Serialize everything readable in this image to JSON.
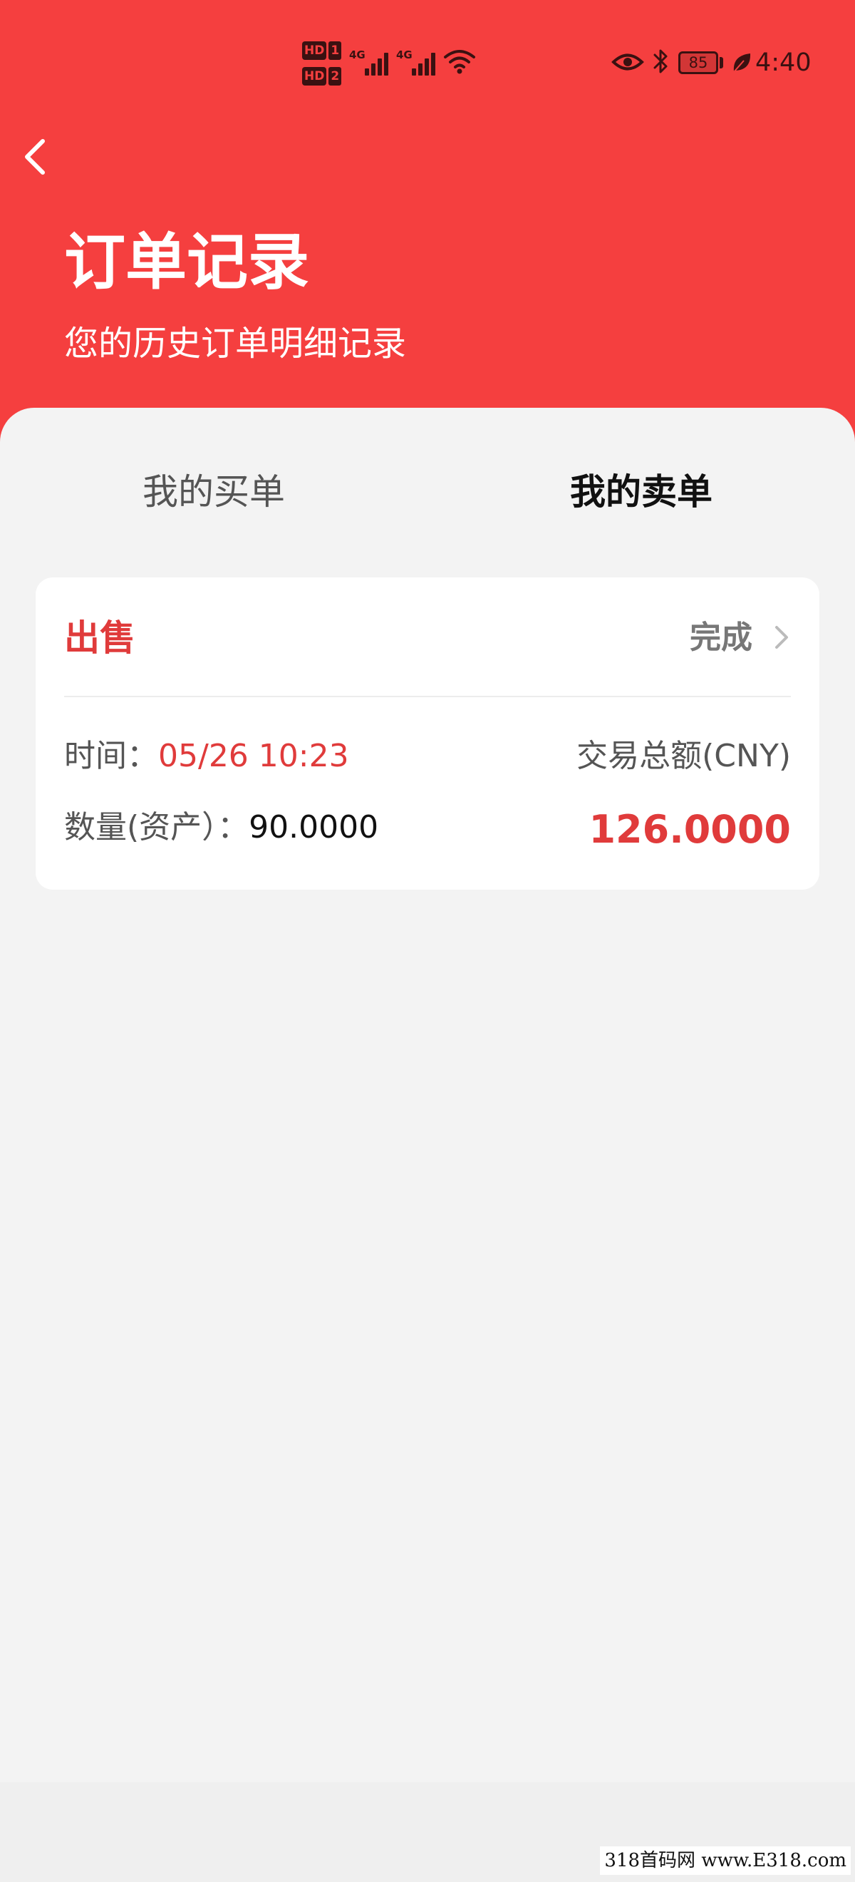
{
  "status_bar": {
    "sim1_label": "HD",
    "sim1_num": "1",
    "sim2_label": "HD",
    "sim2_num": "2",
    "network1": "4G",
    "network2": "4G",
    "battery_level": "85",
    "time": "4:40",
    "icons": [
      "signal-icon",
      "wifi-icon",
      "eye-icon",
      "bluetooth-icon",
      "battery-icon",
      "leaf-icon"
    ]
  },
  "header": {
    "title": "订单记录",
    "subtitle": "您的历史订单明细记录",
    "back_icon": "chevron-left-icon",
    "background_color": "#f53f3f"
  },
  "tabs": [
    {
      "label": "我的买单",
      "active": false
    },
    {
      "label": "我的卖单",
      "active": true
    }
  ],
  "order": {
    "type": "出售",
    "status": "完成",
    "time_label": "时间：",
    "time_value": "05/26 10:23",
    "quantity_label": "数量(资产）：",
    "quantity_value": "90.0000",
    "total_label": "交易总额(CNY)",
    "total_value": "126.0000",
    "accent_color": "#e03b3b"
  },
  "watermark": "318首码网 www.E318.com"
}
